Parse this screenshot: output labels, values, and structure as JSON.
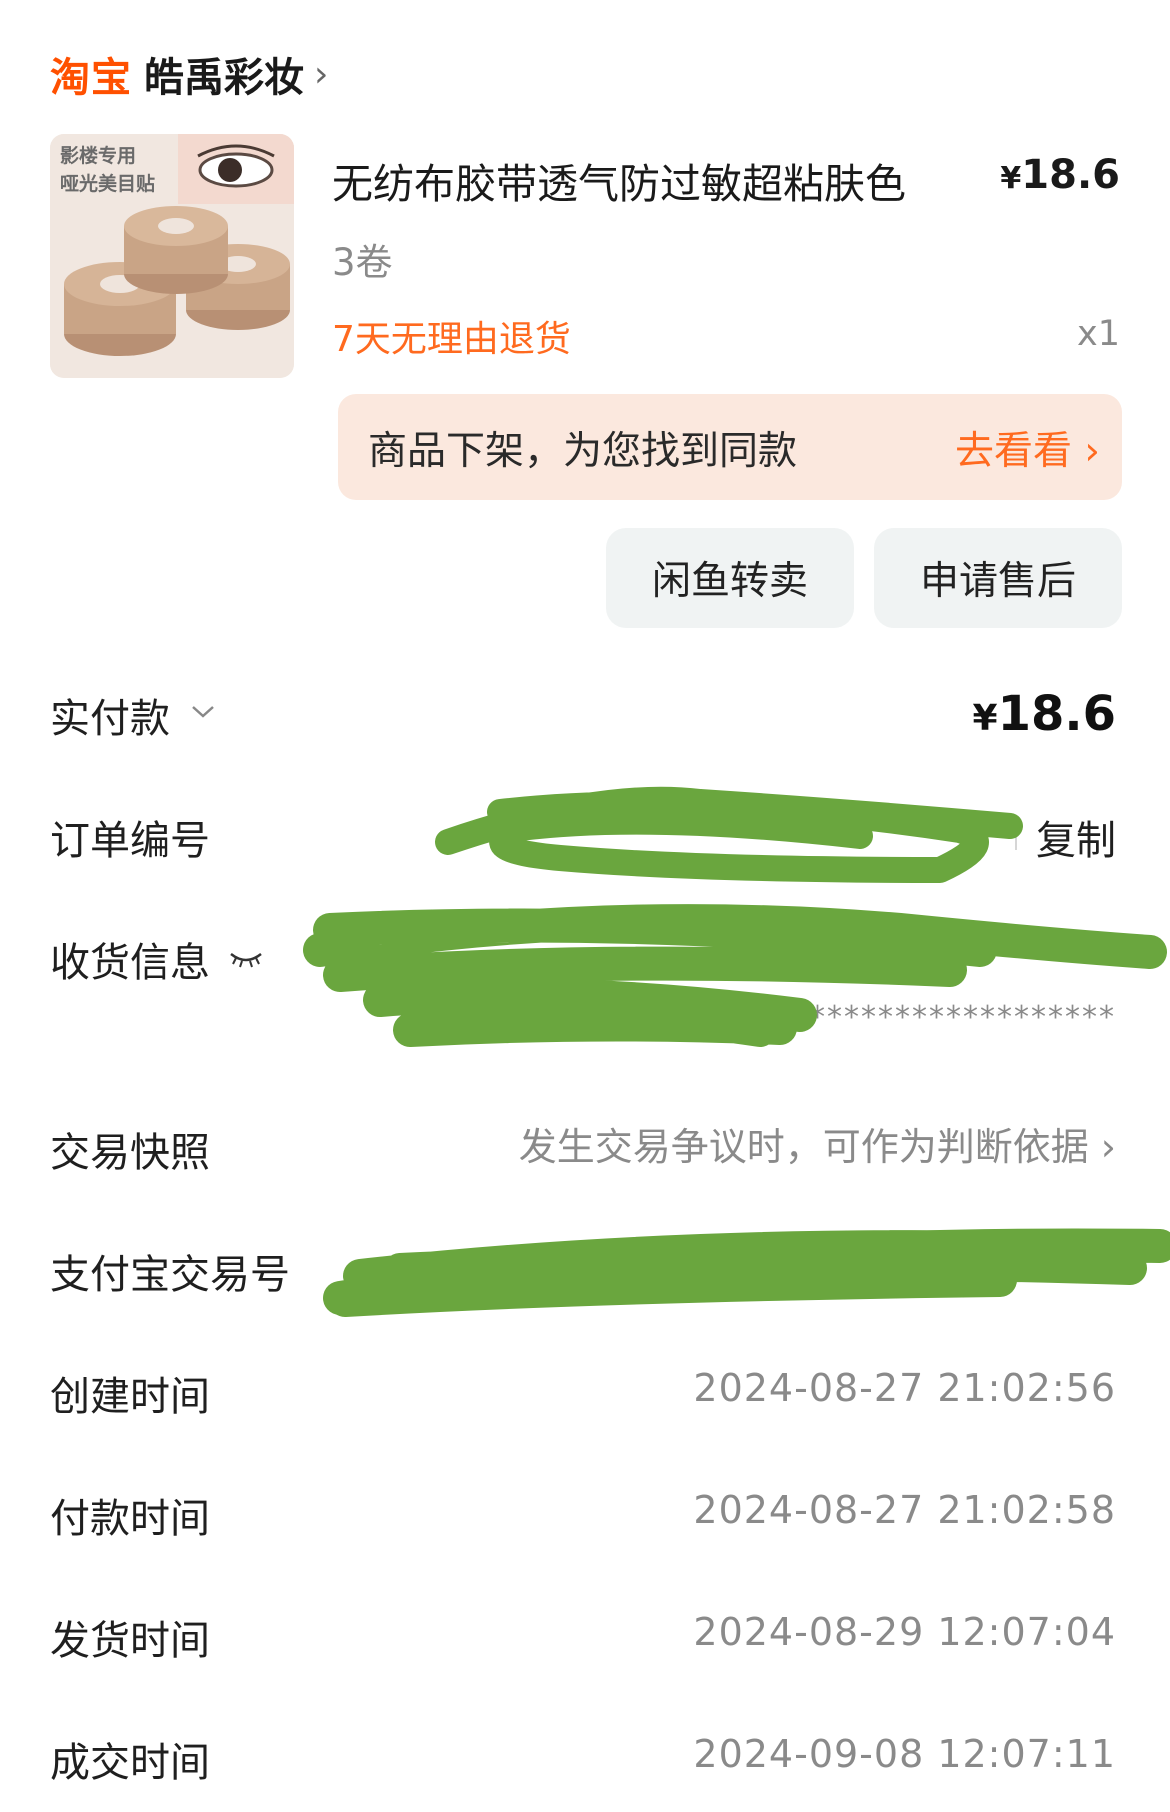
{
  "header": {
    "platform_logo": "淘宝",
    "shop_name": "皓禹彩妆",
    "chevron": "›"
  },
  "product": {
    "thumb_caption_line1": "影楼专用",
    "thumb_caption_line2": "哑光美目贴",
    "title": "无纺布胶带透气防过敏超粘肤色",
    "price_symbol": "¥",
    "price": "18.6",
    "spec": "3卷",
    "return_policy": "7天无理由退货",
    "quantity": "x1"
  },
  "notice": {
    "text": "商品下架，为您找到同款",
    "link": "去看看 ›"
  },
  "actions": {
    "resell": "闲鱼转卖",
    "after_sale": "申请售后"
  },
  "payment": {
    "label": "实付款",
    "symbol": "¥",
    "amount": "18.6"
  },
  "order_number": {
    "label": "订单编号",
    "copy": "复制"
  },
  "shipping": {
    "label": "收货信息",
    "masked": "********************"
  },
  "snapshot": {
    "label": "交易快照",
    "value": "发生交易争议时，可作为判断依据 ›"
  },
  "alipay": {
    "label": "支付宝交易号"
  },
  "times": [
    {
      "label": "创建时间",
      "value": "2024-08-27 21:02:56"
    },
    {
      "label": "付款时间",
      "value": "2024-08-27 21:02:58"
    },
    {
      "label": "发货时间",
      "value": "2024-08-29 12:07:04"
    },
    {
      "label": "成交时间",
      "value": "2024-09-08 12:07:11"
    }
  ],
  "colors": {
    "brand_orange": "#ff5000",
    "accent_orange": "#ff6a1f",
    "redaction_green": "#6aa63e",
    "notice_bg": "#fbe8de"
  }
}
